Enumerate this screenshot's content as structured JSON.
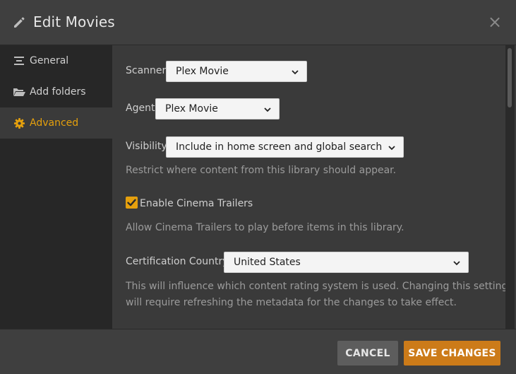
{
  "header": {
    "title": "Edit Movies",
    "close_label": "×"
  },
  "sidebar": {
    "items": [
      {
        "label": "General",
        "icon": "list-icon",
        "active": false
      },
      {
        "label": "Add folders",
        "icon": "folder-icon",
        "active": false
      },
      {
        "label": "Advanced",
        "icon": "gear-icon",
        "active": true
      }
    ]
  },
  "form": {
    "scanner": {
      "label": "Scanner",
      "value": "Plex Movie"
    },
    "agent": {
      "label": "Agent",
      "value": "Plex Movie"
    },
    "visibility": {
      "label": "Visibility",
      "value": "Include in home screen and global search",
      "help": "Restrict where content from this library should appear."
    },
    "cinema_trailers": {
      "label": "Enable Cinema Trailers",
      "checked": true,
      "help": "Allow Cinema Trailers to play before items in this library."
    },
    "certification_country": {
      "label": "Certification Country",
      "value": "United States",
      "help_line1": "This will influence which content rating system is used. Changing this setting",
      "help_line2": "will require refreshing the metadata for the changes to take effect."
    }
  },
  "footer": {
    "cancel_label": "CANCEL",
    "save_label": "SAVE CHANGES"
  },
  "colors": {
    "accent": "#e5a00d",
    "save_button": "#cc7b19",
    "cancel_button": "#5d5d5d"
  }
}
